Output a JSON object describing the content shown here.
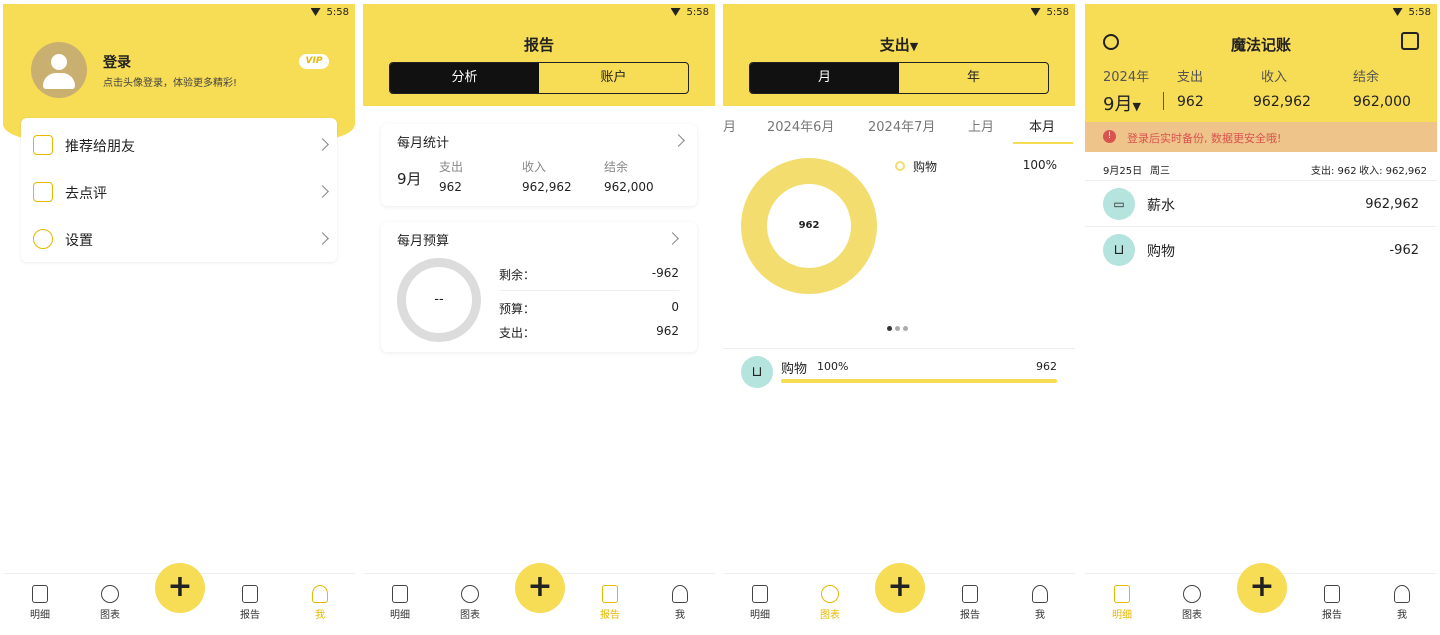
{
  "status": {
    "time": "5:58"
  },
  "tabbar": {
    "mingxi": "明细",
    "tubiao": "图表",
    "add": "+",
    "baogao": "报告",
    "wo": "我"
  },
  "screen1": {
    "login_title": "登录",
    "login_subtitle": "点击头像登录，体验更多精彩!",
    "vip": "VIP",
    "menu": [
      {
        "label": "推荐给朋友",
        "icon": "thumbs-up-icon"
      },
      {
        "label": "去点评",
        "icon": "edit-icon"
      },
      {
        "label": "设置",
        "icon": "settings-icon"
      }
    ]
  },
  "screen2": {
    "title": "报告",
    "seg": [
      "分析",
      "账户"
    ],
    "monthly_stats": {
      "title": "每月统计",
      "month": "9月",
      "labels": [
        "支出",
        "收入",
        "结余"
      ],
      "values": [
        "962",
        "962,962",
        "962,000"
      ]
    },
    "monthly_budget": {
      "title": "每月预算",
      "ring_center": "--",
      "rows": [
        {
          "label": "剩余：",
          "value": "-962"
        },
        {
          "label": "预算：",
          "value": "0"
        },
        {
          "label": "支出：",
          "value": "962"
        }
      ]
    }
  },
  "screen3": {
    "title": "支出",
    "seg": [
      "月",
      "年"
    ],
    "period_tabs": [
      "月",
      "2024年6月",
      "2024年7月",
      "上月",
      "本月"
    ],
    "donut_center": "962",
    "legend": [
      {
        "label": "购物",
        "pct": "100%"
      }
    ],
    "category_rows": [
      {
        "name": "购物",
        "pct": "100%",
        "amount": "962",
        "fraction": 1.0
      }
    ],
    "colors": {
      "donut": "#f2dd6e",
      "accent": "#f7dc55"
    }
  },
  "screen4": {
    "title": "魔法记账",
    "year": "2024年",
    "month": "9月",
    "summary_labels": [
      "支出",
      "收入",
      "结余"
    ],
    "summary_values": [
      "962",
      "962,962",
      "962,000"
    ],
    "notice": "登录后实时备份, 数据更安全哦!",
    "day_header": {
      "date": "9月25日",
      "weekday": "周三",
      "expense": "支出: 962",
      "income": "收入: 962,962"
    },
    "records": [
      {
        "name": "薪水",
        "amount": "962,962",
        "icon": "wallet-icon"
      },
      {
        "name": "购物",
        "amount": "-962",
        "icon": "cart-icon"
      }
    ],
    "colors": {
      "notice_bg": "#eec48a",
      "notice_text": "#d9534f"
    }
  }
}
